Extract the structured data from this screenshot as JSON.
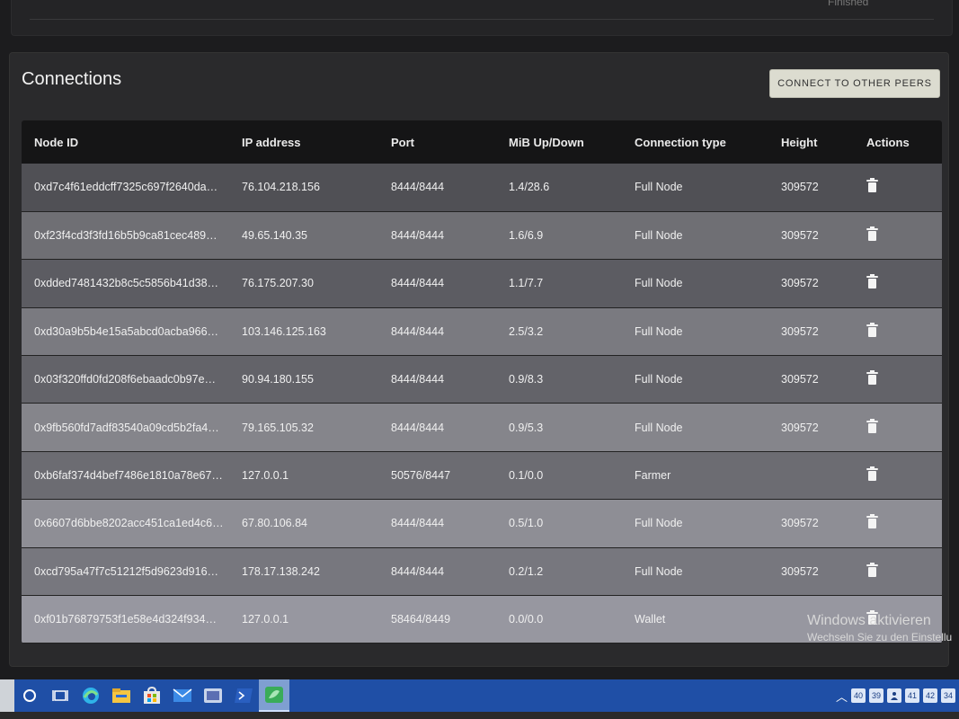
{
  "connections": {
    "title": "Connections",
    "connect_button": "CONNECT TO OTHER PEERS",
    "columns": [
      "Node ID",
      "IP address",
      "Port",
      "MiB Up/Down",
      "Connection type",
      "Height",
      "Actions"
    ],
    "rows": [
      {
        "node_id": "0xd7c4f61eddcff7325c697f2640da…",
        "ip": "76.104.218.156",
        "port": "8444/8444",
        "updown": "1.4/28.6",
        "type": "Full Node",
        "height": "309572"
      },
      {
        "node_id": "0xf23f4cd3f3fd16b5b9ca81cec489…",
        "ip": "49.65.140.35",
        "port": "8444/8444",
        "updown": "1.6/6.9",
        "type": "Full Node",
        "height": "309572"
      },
      {
        "node_id": "0xdded7481432b8c5c5856b41d38…",
        "ip": "76.175.207.30",
        "port": "8444/8444",
        "updown": "1.1/7.7",
        "type": "Full Node",
        "height": "309572"
      },
      {
        "node_id": "0xd30a9b5b4e15a5abcd0acba966…",
        "ip": "103.146.125.163",
        "port": "8444/8444",
        "updown": "2.5/3.2",
        "type": "Full Node",
        "height": "309572"
      },
      {
        "node_id": "0x03f320ffd0fd208f6ebaadc0b97e…",
        "ip": "90.94.180.155",
        "port": "8444/8444",
        "updown": "0.9/8.3",
        "type": "Full Node",
        "height": "309572"
      },
      {
        "node_id": "0x9fb560fd7adf83540a09cd5b2fa4…",
        "ip": "79.165.105.32",
        "port": "8444/8444",
        "updown": "0.9/5.3",
        "type": "Full Node",
        "height": "309572"
      },
      {
        "node_id": "0xb6faf374d4bef7486e1810a78e67…",
        "ip": "127.0.0.1",
        "port": "50576/8447",
        "updown": "0.1/0.0",
        "type": "Farmer",
        "height": ""
      },
      {
        "node_id": "0x6607d6bbe8202acc451ca1ed4c6…",
        "ip": "67.80.106.84",
        "port": "8444/8444",
        "updown": "0.5/1.0",
        "type": "Full Node",
        "height": "309572"
      },
      {
        "node_id": "0xcd795a47f7c51212f5d9623d916…",
        "ip": "178.17.138.242",
        "port": "8444/8444",
        "updown": "0.2/1.2",
        "type": "Full Node",
        "height": "309572"
      },
      {
        "node_id": "0xf01b76879753f1e58e4d324f934…",
        "ip": "127.0.0.1",
        "port": "58464/8449",
        "updown": "0.0/0.0",
        "type": "Wallet",
        "height": ""
      }
    ]
  },
  "watermark": {
    "line1": "Windows aktivieren",
    "line2": "Wechseln Sie zu den Einstellu"
  },
  "top_card": {
    "status": "Finished"
  },
  "taskbar": {
    "icons": [
      "cortana-icon",
      "task-view-icon",
      "edge-icon",
      "file-explorer-icon",
      "store-icon",
      "mail-icon",
      "app-icon",
      "powershell-icon",
      "chia-icon"
    ],
    "tray_badges": [
      "40",
      "39",
      "41",
      "42",
      "34"
    ]
  }
}
